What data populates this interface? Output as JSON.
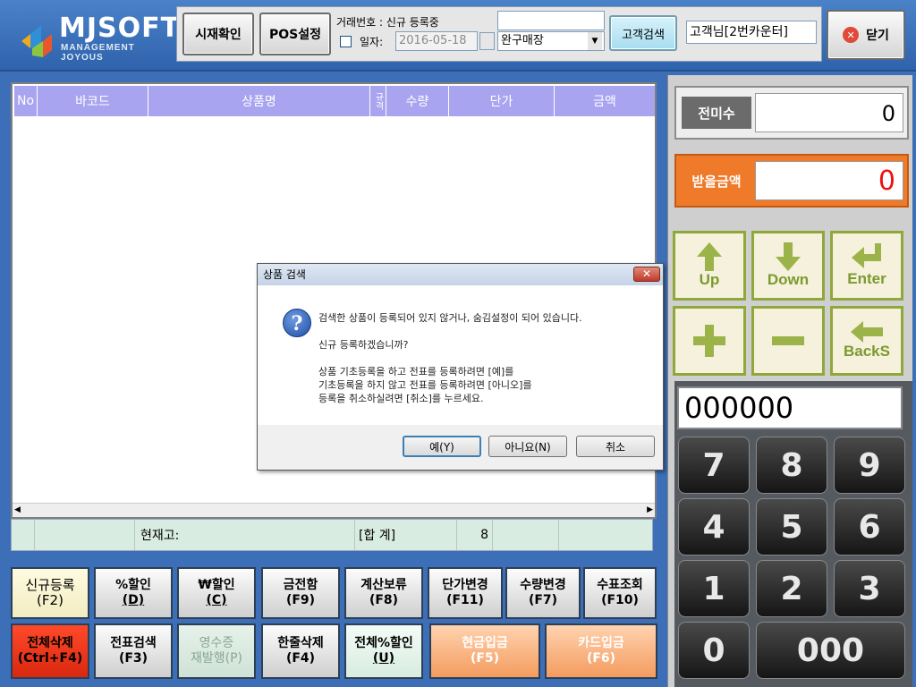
{
  "logo": {
    "brand": "MJSOFT",
    "tagline": "MANAGEMENT JOYOUS"
  },
  "toolbar": {
    "check_register_label": "시재확인",
    "pos_settings_label": "POS설정",
    "transaction_label": "거래번호 : 신규 등록중",
    "transaction_input": "",
    "date_label": "일자:",
    "date_value": "2016-05-18",
    "store_value": "완구매장",
    "customer_search_label": "고객검색",
    "customer_value": "고객님[2번카운터]",
    "close_label": "닫기"
  },
  "grid": {
    "headers": [
      "No",
      "바코드",
      "상품명",
      "규격",
      "수량",
      "단가",
      "금액"
    ],
    "summary": {
      "stock_label": "현재고:",
      "total_label": "[합 계]",
      "total_qty": "8"
    }
  },
  "right": {
    "unpaid_label": "전미수",
    "unpaid_value": "0",
    "receive_label": "받을금액",
    "receive_value": "0",
    "nav": {
      "up": "Up",
      "down": "Down",
      "enter": "Enter",
      "backspace": "BackS"
    },
    "display_value": "000000",
    "keys": [
      "7",
      "8",
      "9",
      "4",
      "5",
      "6",
      "1",
      "2",
      "3",
      "0",
      "000"
    ]
  },
  "buttons": {
    "new_register": {
      "line1": "신규등록",
      "line2": "(F2)"
    },
    "pct_discount": {
      "line1": "%할인",
      "line2": "(D)"
    },
    "won_discount": {
      "line1": "₩할인",
      "line2": "(C)"
    },
    "cash_drawer": {
      "line1": "금전함",
      "line2": "(F9)"
    },
    "hold_calc": {
      "line1": "계산보류",
      "line2": "(F8)"
    },
    "price_change": {
      "line1": "단가변경",
      "line2": "(F11)"
    },
    "qty_change": {
      "line1": "수량변경",
      "line2": "(F7)"
    },
    "check_inquiry": {
      "line1": "수표조회",
      "line2": "(F10)"
    },
    "delete_all": {
      "line1": "전체삭제",
      "line2": "(Ctrl+F4)"
    },
    "slip_search": {
      "line1": "전표검색",
      "line2": "(F3)"
    },
    "receipt_reissue": {
      "line1": "영수증",
      "line2": "재발행(P)"
    },
    "delete_line": {
      "line1": "한줄삭제",
      "line2": "(F4)"
    },
    "all_pct_discount": {
      "line1": "전체%할인",
      "line2": "(U)"
    },
    "cash_payment": {
      "line1": "현금입금",
      "line2": "(F5)"
    },
    "card_payment": {
      "line1": "카드입금",
      "line2": "(F6)"
    }
  },
  "dialog": {
    "title": "상품 검색",
    "line1": "검색한 상품이 등록되어 있지 않거나, 숨김설정이 되어 있습니다.",
    "line2": "신규 등록하겠습니까?",
    "line3": "상품 기초등록을 하고 전표를 등록하려면 [예]를",
    "line4": "기초등록을 하지 않고 전표를 등록하려면 [아니오]를",
    "line5": "등록을 취소하실려면 [취소]를 누르세요.",
    "yes": "예(Y)",
    "no": "아니요(N)",
    "cancel": "취소"
  },
  "colors": {
    "header_purple": "#a8a4f0",
    "receive_orange": "#ef7a2a",
    "delete_red": "#e8311f",
    "nav_green": "#8fa83a"
  }
}
